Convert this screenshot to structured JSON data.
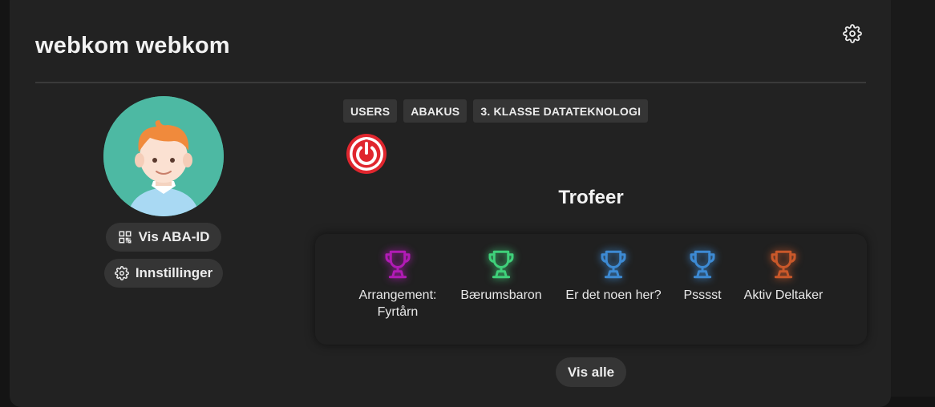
{
  "profile": {
    "name": "webkom webkom",
    "settings_icon": "gear-icon",
    "aba_button_label": "Vis ABA-ID",
    "aba_button_icon": "qr-code-icon",
    "settings_button_label": "Innstillinger",
    "settings_button_icon": "gear-icon"
  },
  "tags": [
    "USERS",
    "ABAKUS",
    "3. KLASSE DATATEKNOLOGI"
  ],
  "status_icon": "power-icon",
  "trophies": {
    "heading": "Trofeer",
    "items": [
      {
        "label": "Arrangement: Fyrtårn",
        "color": "#b11bb5",
        "icon": "trophy-icon"
      },
      {
        "label": "Bærumsbaron",
        "color": "#3fd07a",
        "icon": "trophy-icon"
      },
      {
        "label": "Er det noen her?",
        "color": "#3d8ad3",
        "icon": "trophy-icon"
      },
      {
        "label": "Psssst",
        "color": "#3d8ad3",
        "icon": "trophy-icon"
      },
      {
        "label": "Aktiv Deltaker",
        "color": "#c9582a",
        "icon": "trophy-icon"
      }
    ],
    "show_all_label": "Vis alle"
  },
  "colors": {
    "background": "#141414",
    "card": "#222222",
    "pill": "#353535",
    "power": "#e0262e",
    "avatar_bg": "#4db9a3"
  }
}
